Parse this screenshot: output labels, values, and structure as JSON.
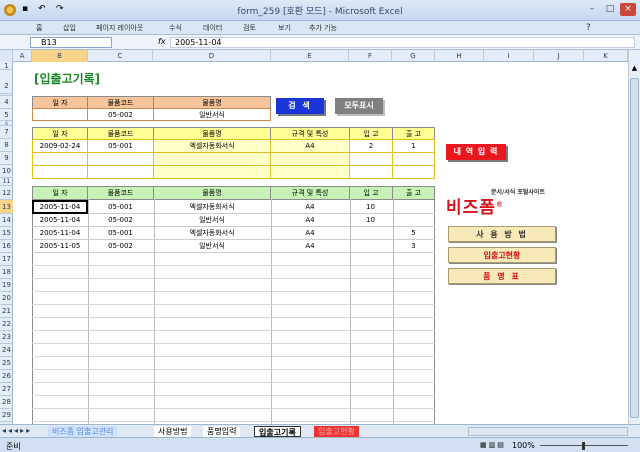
{
  "window": {
    "title": "form_259  [호환 모드] - Microsoft Excel"
  },
  "ribbon_tabs": [
    "홈",
    "삽입",
    "페이지 레이아웃",
    "수식",
    "데이터",
    "검토",
    "보기",
    "추가 기능"
  ],
  "formula_bar": {
    "name_box": "B13",
    "fx": "fx",
    "value": "2005-11-04"
  },
  "columns": [
    "A",
    "B",
    "C",
    "D",
    "E",
    "F",
    "G",
    "H",
    "I",
    "J",
    "K"
  ],
  "rows": [
    "1",
    "2",
    "3",
    "4",
    "5",
    "6",
    "7",
    "8",
    "9",
    "10",
    "11",
    "12",
    "13",
    "14",
    "15",
    "16",
    "17",
    "18",
    "19",
    "20",
    "21",
    "22",
    "23",
    "24",
    "25",
    "26",
    "27",
    "28",
    "29"
  ],
  "page_title": "[입출고기록]",
  "search": {
    "headers": [
      "일 자",
      "물품코드",
      "물품명"
    ],
    "values": [
      "",
      "05-002",
      "일반서식"
    ]
  },
  "buttons": {
    "search": "검 색",
    "show_all": "모두표시",
    "input": "내 역 입 력",
    "usage": "사 용 방 법",
    "inout_status": "입출고현황",
    "item_list": "품 명 표"
  },
  "entry": {
    "headers": [
      "일 자",
      "물품코드",
      "물품명",
      "규격 및 특성",
      "입 고",
      "출 고"
    ],
    "row": [
      "2009-02-24",
      "05-001",
      "엑셀자동화서식",
      "A4",
      "2",
      "1"
    ]
  },
  "records": {
    "headers": [
      "일 자",
      "물품코드",
      "물품명",
      "규격 및 특성",
      "입 고",
      "출 고"
    ],
    "rows": [
      [
        "2005-11-04",
        "05-001",
        "엑셀자동화서식",
        "A4",
        "10",
        ""
      ],
      [
        "2005-11-04",
        "05-002",
        "일반서식",
        "A4",
        "10",
        ""
      ],
      [
        "2005-11-04",
        "05-001",
        "엑셀자동화서식",
        "A4",
        "",
        "5"
      ],
      [
        "2005-11-05",
        "05-002",
        "일반서식",
        "A4",
        "",
        "3"
      ]
    ]
  },
  "logo": {
    "tagline": "문서/서식 포털사이트",
    "name": "비즈폼",
    "mark": "®"
  },
  "sheet_tabs": {
    "tab0": "비즈폼 입출고관리",
    "tab1": "사용방법",
    "tab2": "품명입력",
    "tab3": "입출고기록",
    "tab4": "입출고현황"
  },
  "status": {
    "ready": "준비",
    "zoom": "100%"
  },
  "colors": {
    "orange_header": "#f5c49b",
    "yellow_header": "#ffff96",
    "green_header": "#c7f2b5",
    "search_btn": "#1a35d8",
    "input_btn": "#e8181c",
    "title_green": "#1e8a2a"
  }
}
